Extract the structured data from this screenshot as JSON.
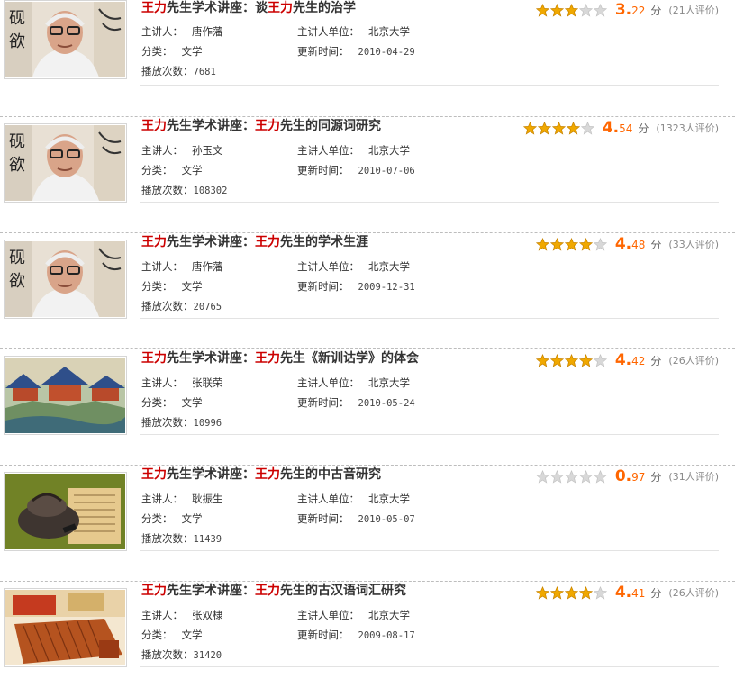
{
  "labels": {
    "lecturer": "主讲人：",
    "unit": "主讲人单位：",
    "category": "分类：",
    "updated": "更新时间：",
    "plays": "播放次数：",
    "score_unit": "分"
  },
  "colors": {
    "highlight": "#cc0000",
    "score": "#ff6600",
    "star_on": "#f0a800",
    "star_off": "#d8d8d8"
  },
  "items": [
    {
      "title_hl1": "王力",
      "title_mid": "先生学术讲座：谈",
      "title_hl2": "王力",
      "title_end": "先生的治学",
      "lecturer": "唐作藩",
      "unit": "北京大学",
      "category": "文学",
      "updated": "2010-04-29",
      "plays": "7681",
      "score_int": "3.",
      "score_dec": "22",
      "rating_count": "(21人评价)",
      "stars": 3,
      "thumb": "portrait-icon"
    },
    {
      "title_hl1": "王力",
      "title_mid": "先生学术讲座：",
      "title_hl2": "王力",
      "title_end": "先生的同源词研究",
      "lecturer": "孙玉文",
      "unit": "北京大学",
      "category": "文学",
      "updated": "2010-07-06",
      "plays": "108302",
      "score_int": "4.",
      "score_dec": "54",
      "rating_count": "(1323人评价)",
      "stars": 4,
      "thumb": "portrait-icon"
    },
    {
      "title_hl1": "王力",
      "title_mid": "先生学术讲座：",
      "title_hl2": "王力",
      "title_end": "先生的学术生涯",
      "lecturer": "唐作藩",
      "unit": "北京大学",
      "category": "文学",
      "updated": "2009-12-31",
      "plays": "20765",
      "score_int": "4.",
      "score_dec": "48",
      "rating_count": "(33人评价)",
      "stars": 4,
      "thumb": "portrait-icon"
    },
    {
      "title_hl1": "王力",
      "title_mid": "先生学术讲座：",
      "title_hl2": "王力",
      "title_end": "先生《新训诂学》的体会",
      "lecturer": "张联荣",
      "unit": "北京大学",
      "category": "文学",
      "updated": "2010-05-24",
      "plays": "10996",
      "score_int": "4.",
      "score_dec": "42",
      "rating_count": "(26人评价)",
      "stars": 4,
      "thumb": "palace-painting-icon"
    },
    {
      "title_hl1": "王力",
      "title_mid": "先生学术讲座：",
      "title_hl2": "王力",
      "title_end": "先生的中古音研究",
      "lecturer": "耿振生",
      "unit": "北京大学",
      "category": "文学",
      "updated": "2010-05-07",
      "plays": "11439",
      "score_int": "0.",
      "score_dec": "97",
      "rating_count": "(31人评价)",
      "stars": 0,
      "thumb": "inkstone-icon"
    },
    {
      "title_hl1": "王力",
      "title_mid": "先生学术讲座：",
      "title_hl2": "王力",
      "title_end": "先生的古汉语词汇研究",
      "lecturer": "张双棣",
      "unit": "北京大学",
      "category": "文学",
      "updated": "2009-08-17",
      "plays": "31420",
      "score_int": "4.",
      "score_dec": "41",
      "rating_count": "(26人评价)",
      "stars": 4,
      "thumb": "bamboo-book-icon"
    }
  ]
}
